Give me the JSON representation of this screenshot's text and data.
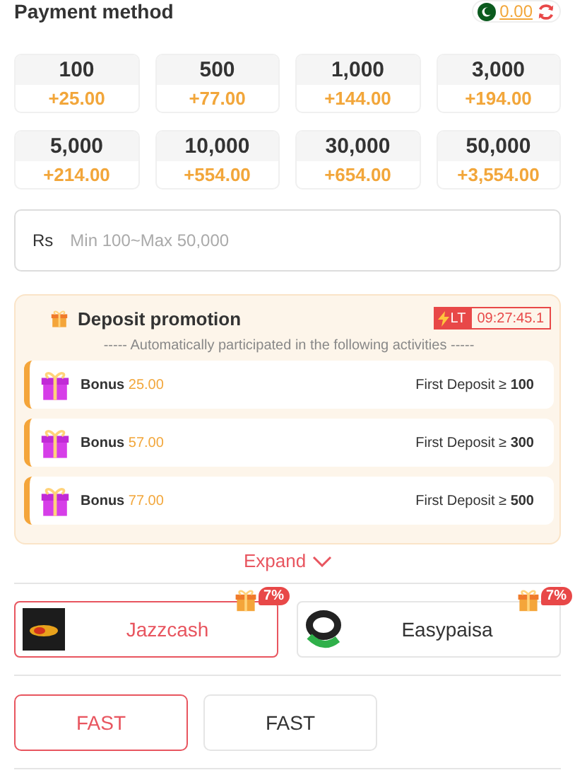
{
  "header": {
    "title": "Payment method",
    "balance": "0.00"
  },
  "amounts": [
    {
      "amount": "100",
      "bonus": "+25.00"
    },
    {
      "amount": "500",
      "bonus": "+77.00"
    },
    {
      "amount": "1,000",
      "bonus": "+144.00"
    },
    {
      "amount": "3,000",
      "bonus": "+194.00"
    },
    {
      "amount": "5,000",
      "bonus": "+214.00"
    },
    {
      "amount": "10,000",
      "bonus": "+554.00"
    },
    {
      "amount": "30,000",
      "bonus": "+654.00"
    },
    {
      "amount": "50,000",
      "bonus": "+3,554.00"
    }
  ],
  "amount_field": {
    "prefix": "Rs",
    "placeholder": "Min 100~Max 50,000"
  },
  "promotion": {
    "title": "Deposit promotion",
    "badge": "LT",
    "countdown": "09:27:45.1",
    "subtitle": "----- Automatically participated in the following activities -----",
    "items": [
      {
        "label": "Bonus",
        "value": "25.00",
        "condition": "First Deposit ≥ **100**"
      },
      {
        "label": "Bonus",
        "value": "57.00",
        "condition": "First Deposit ≥ **300**"
      },
      {
        "label": "Bonus",
        "value": "77.00",
        "condition": "First Deposit ≥ **500**"
      }
    ]
  },
  "expand": "Expand",
  "methods": [
    {
      "name": "Jazzcash",
      "badge": "7%",
      "selected": true,
      "kind": "jazz"
    },
    {
      "name": "Easypaisa",
      "badge": "7%",
      "selected": false,
      "kind": "easy"
    }
  ],
  "channels": [
    {
      "label": "FAST",
      "selected": true
    },
    {
      "label": "FAST",
      "selected": false
    }
  ]
}
